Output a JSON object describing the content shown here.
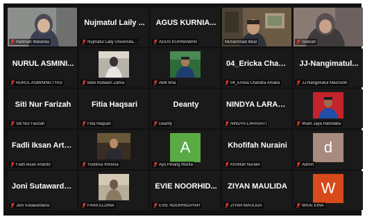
{
  "participants": [
    {
      "display": "",
      "label": "Rahmah Walanda",
      "kind": "video"
    },
    {
      "display": "Nujmatul Laily ...",
      "label": "Nujmatul Laily Universita...",
      "kind": "name"
    },
    {
      "display": "AGUS KURNIA...",
      "label": "AGUS KURNIAWAN",
      "kind": "name"
    },
    {
      "display": "",
      "label": "Muhammad Ikbal",
      "kind": "video"
    },
    {
      "display": "",
      "label": "Sukkah",
      "kind": "video"
    },
    {
      "display": "NURUL ASMINI...",
      "label": "NURUL ASMININGTYAS",
      "kind": "name"
    },
    {
      "display": "",
      "label": "Bebi Rubiasri Zahra",
      "kind": "photo"
    },
    {
      "display": "",
      "label": "Abill Ilma",
      "kind": "photo"
    },
    {
      "display": "04_Ericka Chan...",
      "label": "04_Ericka Chandra Amalia",
      "kind": "name"
    },
    {
      "display": "JJ-Nangimatul...",
      "label": "JJ-Nangimatul Masruroh",
      "kind": "name"
    },
    {
      "display": "Siti Nur Farizah",
      "label": "Siti Nur Farizah",
      "kind": "name"
    },
    {
      "display": "Fitia Haqsari",
      "label": "Fitia Haqsari",
      "kind": "name"
    },
    {
      "display": "Deanty",
      "label": "Deanty",
      "kind": "name"
    },
    {
      "display": "NINDYA LARAS...",
      "label": "NINDYA LARASATI",
      "kind": "name"
    },
    {
      "display": "",
      "label": "Ilham Jaya Hamdalla",
      "kind": "photo"
    },
    {
      "display": "Fadli Iksan Arta...",
      "label": "Fadli Iksan Artanto",
      "kind": "name"
    },
    {
      "display": "",
      "label": "Yustinus Khrisna",
      "kind": "photo"
    },
    {
      "display": "A",
      "label": "Ayu Pinang Marita",
      "kind": "avatar",
      "color": "#5aaa46"
    },
    {
      "display": "Khofifah Nuraini",
      "label": "Khofifah Nuraini",
      "kind": "name"
    },
    {
      "display": "d",
      "label": "Admin",
      "kind": "avatar",
      "color": "#a88a7e"
    },
    {
      "display": "Joni Sutawardana",
      "label": "Joni Sutawardana",
      "kind": "name"
    },
    {
      "display": "",
      "label": "FARA ELDINA",
      "kind": "photo"
    },
    {
      "display": "EVIE NOORHID...",
      "label": "EVIE NOORHIDAYAH",
      "kind": "name"
    },
    {
      "display": "ZIYAN MAULIDA",
      "label": "ZIYAN MAULIDA",
      "kind": "name"
    },
    {
      "display": "W",
      "label": "WIGE EINA",
      "kind": "avatar",
      "color": "#d84a1b"
    }
  ],
  "colors": {
    "mic_muted": "#e23b2e",
    "active_speaker": "#d9d23a",
    "tile_bg": "#1a1a1a"
  }
}
